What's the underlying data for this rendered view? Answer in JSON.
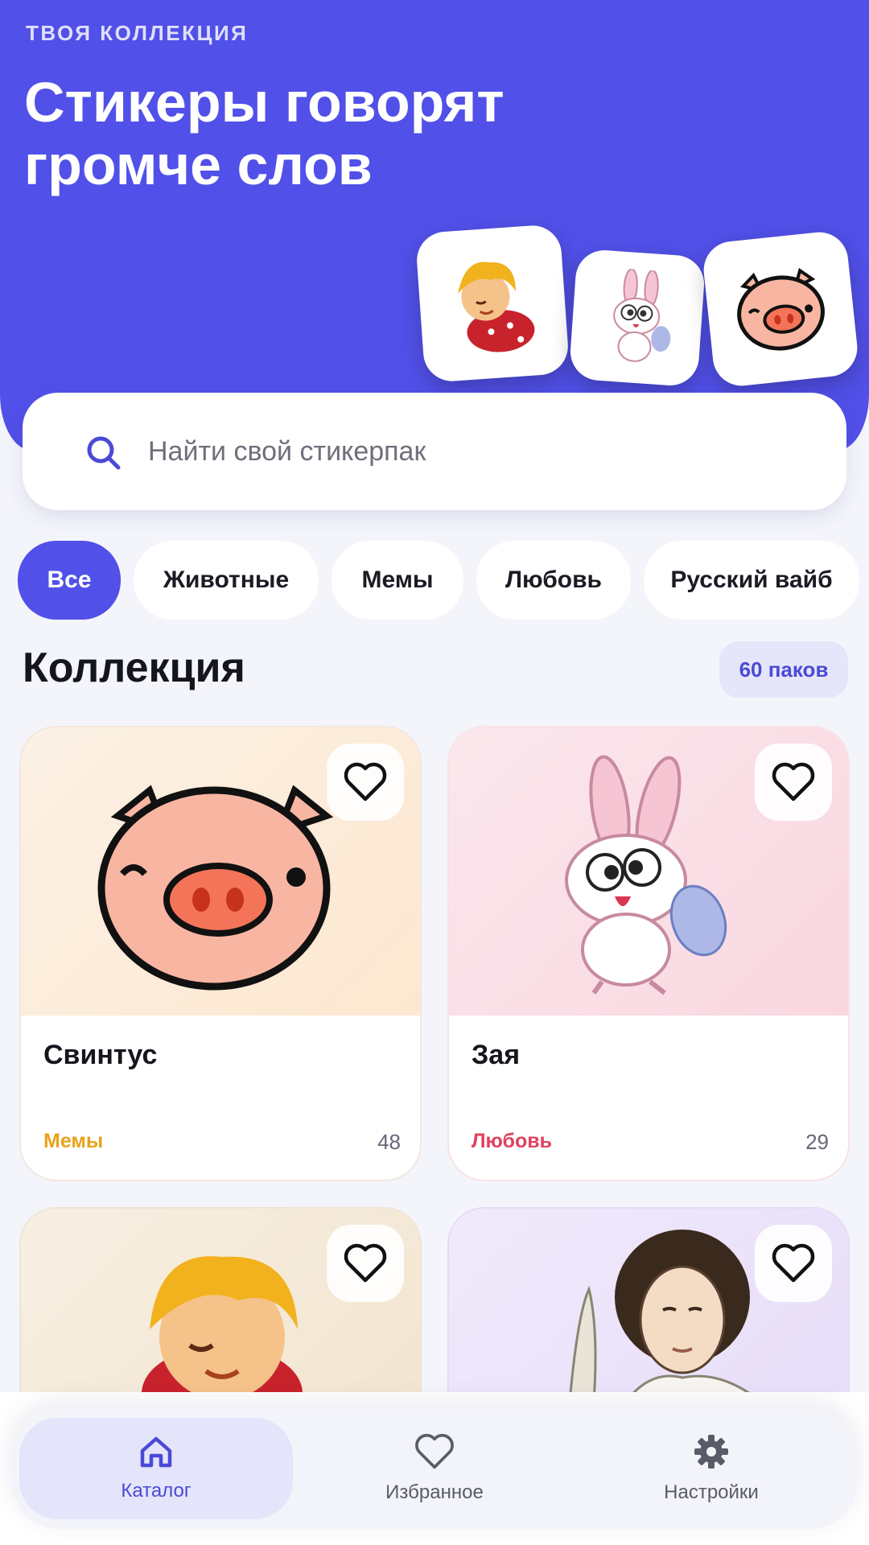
{
  "header": {
    "eyebrow": "ТВОЯ КОЛЛЕКЦИЯ",
    "title": "Стикеры говорят громче слов",
    "stickers": [
      "boy-sticker-icon",
      "bunny-sticker-icon",
      "pig-sticker-icon"
    ]
  },
  "search": {
    "placeholder": "Найти свой стикерпак"
  },
  "chips": [
    {
      "label": "Все",
      "active": true
    },
    {
      "label": "Животные",
      "active": false
    },
    {
      "label": "Мемы",
      "active": false
    },
    {
      "label": "Любовь",
      "active": false
    },
    {
      "label": "Русский вайб",
      "active": false
    }
  ],
  "section": {
    "title": "Коллекция",
    "count": "60 паков"
  },
  "cards": [
    {
      "name": "Свинтус",
      "tag": "Мемы",
      "count": "48",
      "tag_color": "#e8a21a",
      "icon": "pig-sticker-icon"
    },
    {
      "name": "Зая",
      "tag": "Любовь",
      "count": "29",
      "tag_color": "#e0405f",
      "icon": "bunny-sticker-icon"
    },
    {
      "name": "",
      "tag": "",
      "count": "",
      "icon": "boy-sticker-icon"
    },
    {
      "name": "",
      "tag": "",
      "count": "",
      "icon": "poet-sticker-icon"
    }
  ],
  "bottom_nav": [
    {
      "label": "Каталог",
      "icon": "home-icon",
      "active": true
    },
    {
      "label": "Избранное",
      "icon": "heart-icon",
      "active": false
    },
    {
      "label": "Настройки",
      "icon": "gear-icon",
      "active": false
    }
  ],
  "colors": {
    "accent": "#5150e8",
    "background": "#f4f5fb"
  }
}
